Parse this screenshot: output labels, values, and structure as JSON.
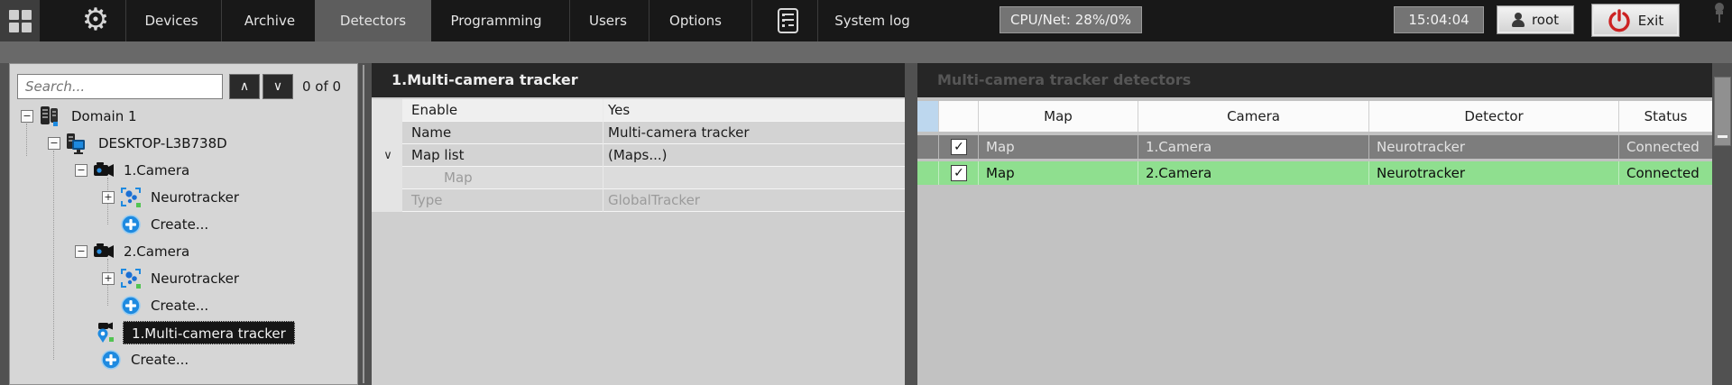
{
  "topbar": {
    "tabs": [
      {
        "label": "Devices"
      },
      {
        "label": "Archive"
      },
      {
        "label": "Detectors",
        "active": true
      },
      {
        "label": "Programming"
      },
      {
        "label": "Users"
      },
      {
        "label": "Options"
      }
    ],
    "system_log_label": "System log",
    "cpu_net": "CPU/Net: 28%/0%",
    "time": "15:04:04",
    "user_label": "root",
    "exit_label": "Exit"
  },
  "search": {
    "placeholder": "Search...",
    "count": "0 of 0",
    "prev_glyph": "∧",
    "next_glyph": "∨"
  },
  "tree": {
    "rows": [
      {
        "label": "Domain 1",
        "toggle": "−",
        "icon": "domain"
      },
      {
        "label": "DESKTOP-L3B738D",
        "toggle": "−",
        "icon": "host"
      },
      {
        "label": "1.Camera",
        "toggle": "−",
        "icon": "camera"
      },
      {
        "label": "Neurotracker",
        "toggle": "+",
        "icon": "neurotracker"
      },
      {
        "label": "Create...",
        "icon": "create"
      },
      {
        "label": "2.Camera",
        "toggle": "−",
        "icon": "camera"
      },
      {
        "label": "Neurotracker",
        "toggle": "+",
        "icon": "neurotracker"
      },
      {
        "label": "Create...",
        "icon": "create"
      },
      {
        "label": "1.Multi-camera tracker",
        "icon": "multi-camera-tracker",
        "selected": true
      },
      {
        "label": "Create...",
        "icon": "create"
      }
    ]
  },
  "properties": {
    "title": "1.Multi-camera tracker",
    "rows": [
      {
        "label": "Enable",
        "value": "Yes"
      },
      {
        "label": "Name",
        "value": "Multi-camera tracker"
      },
      {
        "label": "Map list",
        "value": "(Maps...)",
        "expander": "∨"
      },
      {
        "label": "Map",
        "value": "",
        "disabled": true,
        "indented": true
      },
      {
        "label": "Type",
        "value": "GlobalTracker",
        "disabled": true
      }
    ]
  },
  "detectors": {
    "title": "Multi-camera tracker detectors",
    "columns": {
      "map": "Map",
      "camera": "Camera",
      "detector": "Detector",
      "status": "Status"
    },
    "check_glyph": "✓",
    "rows": [
      {
        "checked": true,
        "map": "Map",
        "camera": "1.Camera",
        "detector": "Neurotracker",
        "status": "Connected",
        "state": "selected-gray"
      },
      {
        "checked": true,
        "map": "Map",
        "camera": "2.Camera",
        "detector": "Neurotracker",
        "status": "Connected",
        "state": "active-green"
      }
    ]
  },
  "colors": {
    "row_selected_gray": "#7d7d7d",
    "row_active_green": "#8fdf8f",
    "header_corner_blue": "#bdd7ee",
    "create_blue": "#1e8ae0",
    "exit_red": "#cc2222",
    "topbar_bg": "#181818",
    "panel_bg": "#d6d6d6"
  }
}
